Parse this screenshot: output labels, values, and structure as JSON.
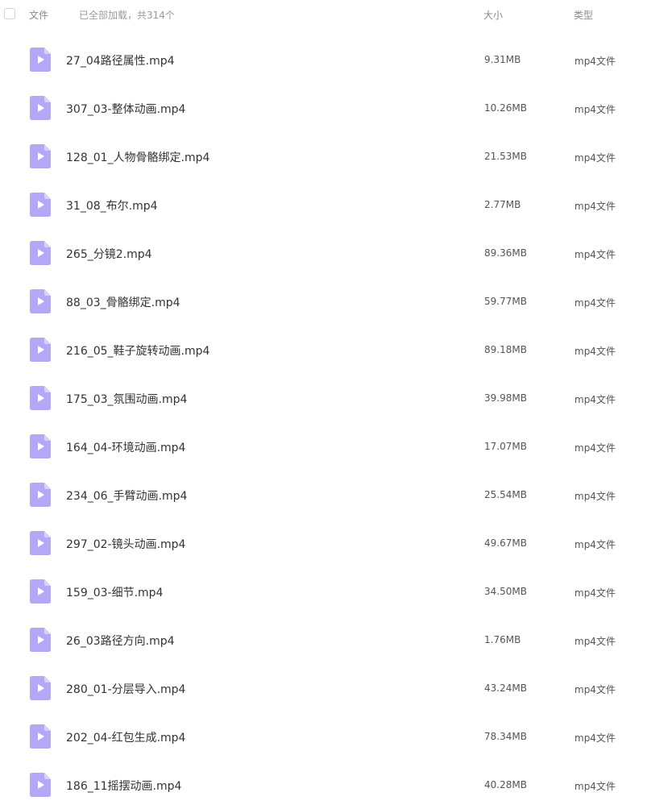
{
  "header": {
    "name_label": "文件",
    "status": "已全部加载，共314个",
    "size_label": "大小",
    "type_label": "类型"
  },
  "colors": {
    "file_icon": "#b4a7f5",
    "file_icon_fold": "#d8d0fb"
  },
  "icons": {
    "file": "video-file-icon"
  },
  "files": [
    {
      "name": "27_04路径属性.mp4",
      "size": "9.31MB",
      "type": "mp4文件"
    },
    {
      "name": "307_03-整体动画.mp4",
      "size": "10.26MB",
      "type": "mp4文件"
    },
    {
      "name": "128_01_人物骨骼绑定.mp4",
      "size": "21.53MB",
      "type": "mp4文件"
    },
    {
      "name": "31_08_布尔.mp4",
      "size": "2.77MB",
      "type": "mp4文件"
    },
    {
      "name": "265_分镜2.mp4",
      "size": "89.36MB",
      "type": "mp4文件"
    },
    {
      "name": "88_03_骨骼绑定.mp4",
      "size": "59.77MB",
      "type": "mp4文件"
    },
    {
      "name": "216_05_鞋子旋转动画.mp4",
      "size": "89.18MB",
      "type": "mp4文件"
    },
    {
      "name": "175_03_氛围动画.mp4",
      "size": "39.98MB",
      "type": "mp4文件"
    },
    {
      "name": "164_04-环境动画.mp4",
      "size": "17.07MB",
      "type": "mp4文件"
    },
    {
      "name": "234_06_手臂动画.mp4",
      "size": "25.54MB",
      "type": "mp4文件"
    },
    {
      "name": "297_02-镜头动画.mp4",
      "size": "49.67MB",
      "type": "mp4文件"
    },
    {
      "name": "159_03-细节.mp4",
      "size": "34.50MB",
      "type": "mp4文件"
    },
    {
      "name": "26_03路径方向.mp4",
      "size": "1.76MB",
      "type": "mp4文件"
    },
    {
      "name": "280_01-分层导入.mp4",
      "size": "43.24MB",
      "type": "mp4文件"
    },
    {
      "name": "202_04-红包生成.mp4",
      "size": "78.34MB",
      "type": "mp4文件"
    },
    {
      "name": "186_11摇摆动画.mp4",
      "size": "40.28MB",
      "type": "mp4文件"
    }
  ]
}
